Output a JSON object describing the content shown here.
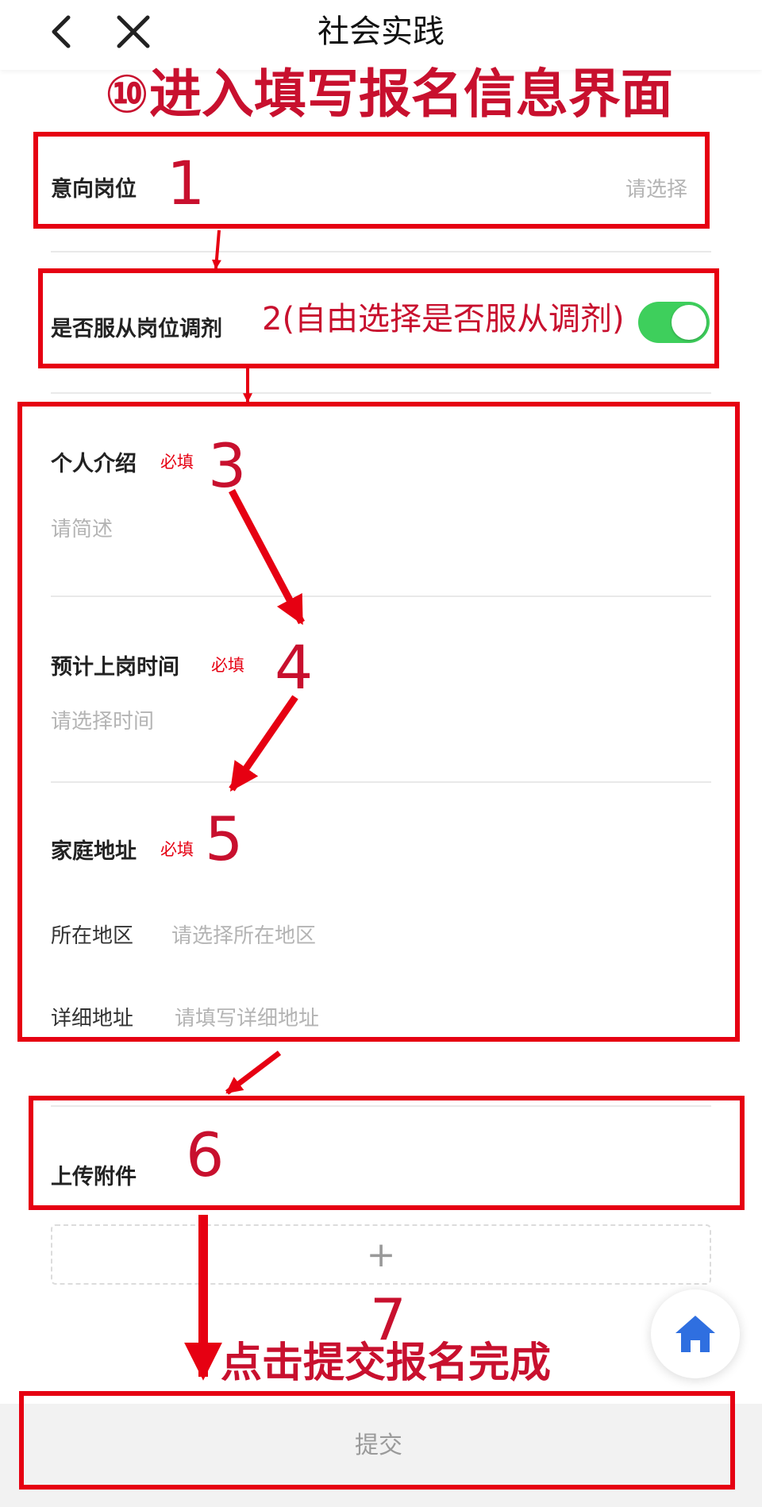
{
  "header": {
    "back_icon": "chevron-left-icon",
    "close_icon": "close-icon",
    "title": "社会实践"
  },
  "annotation": {
    "step_title": "⑩进入填写报名信息界面",
    "n1": "1",
    "n2": "2(自由选择是否服从调剂)",
    "n3": "3",
    "n4": "4",
    "n5": "5",
    "n6": "6",
    "n7": "7",
    "final_note": "点击提交报名完成"
  },
  "form": {
    "position": {
      "label": "意向岗位",
      "placeholder": "请选择"
    },
    "obey": {
      "label": "是否服从岗位调剂",
      "enabled": true
    },
    "intro": {
      "label": "个人介绍",
      "required": "必填",
      "placeholder": "请简述"
    },
    "start_time": {
      "label": "预计上岗时间",
      "required": "必填",
      "placeholder": "请选择时间"
    },
    "address": {
      "label": "家庭地址",
      "required": "必填",
      "region_label": "所在地区",
      "region_placeholder": "请选择所在地区",
      "detail_label": "详细地址",
      "detail_placeholder": "请填写详细地址"
    },
    "attachment": {
      "label": "上传附件",
      "add_symbol": "+"
    }
  },
  "home_icon": "home-icon",
  "submit_label": "提交",
  "colors": {
    "annotation_red": "#e60012",
    "switch_on": "#3ecf5c",
    "home_blue": "#2f6fe0"
  }
}
